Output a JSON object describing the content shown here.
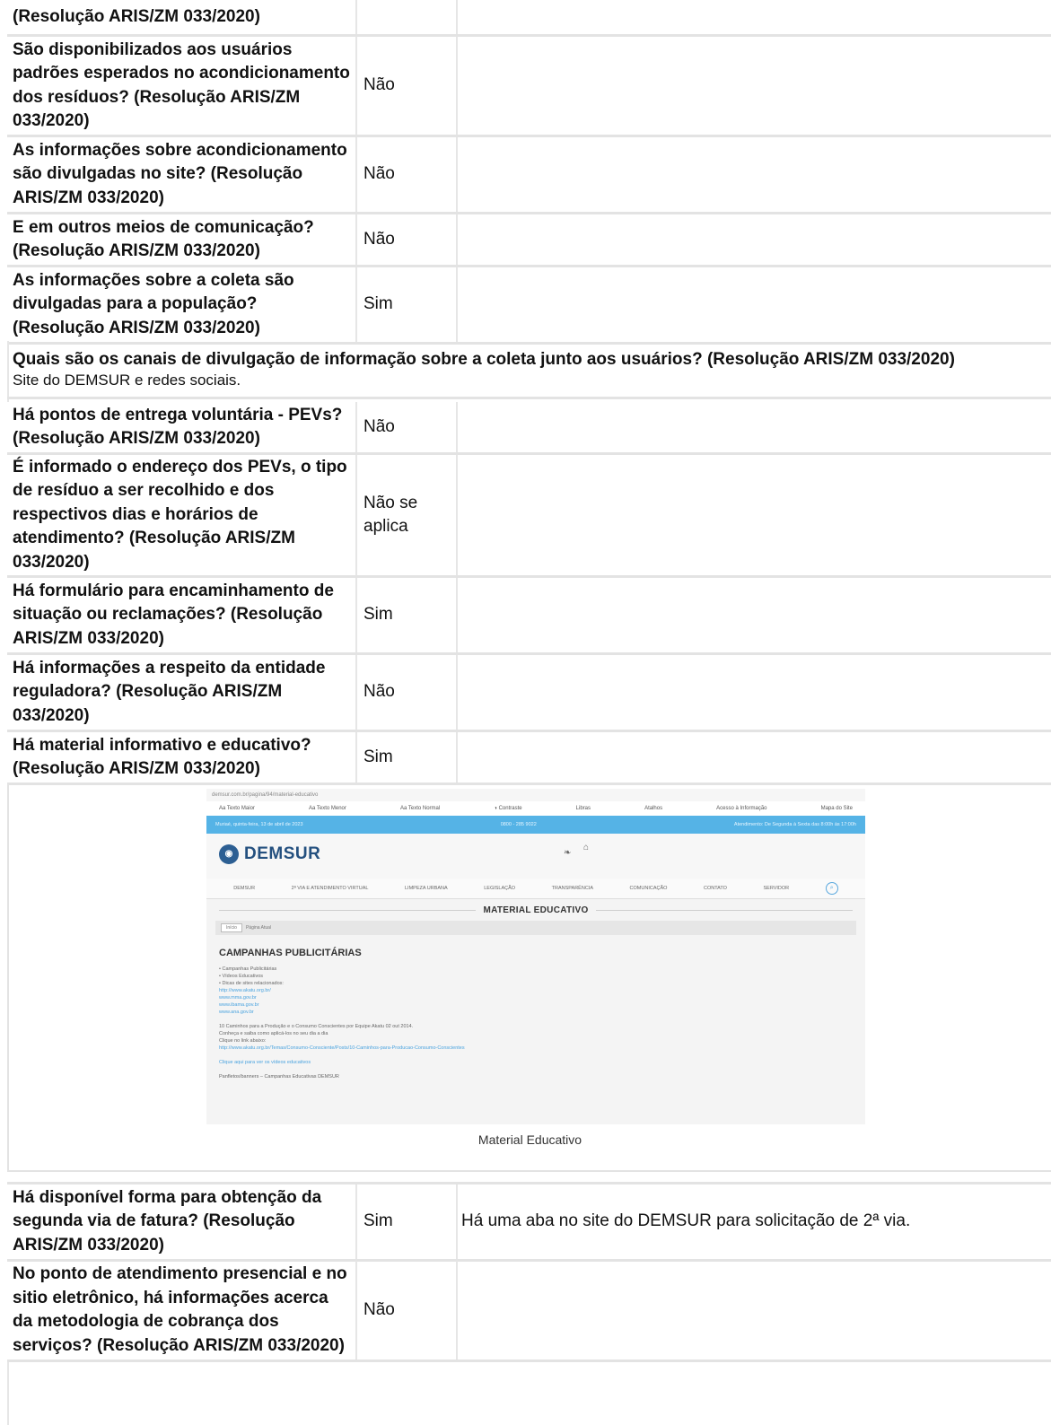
{
  "rows_top": [
    {
      "question": "(Resolução ARIS/ZM 033/2020)",
      "answer": "",
      "comment": ""
    },
    {
      "question": "São disponibilizados aos usuários padrões esperados no acondicionamento dos resíduos? (Resolução ARIS/ZM 033/2020)",
      "answer": "Não",
      "comment": ""
    },
    {
      "question": "As informações sobre acondicionamento são divulgadas no site? (Resolução ARIS/ZM 033/2020)",
      "answer": "Não",
      "comment": ""
    },
    {
      "question": "E em outros meios de comunicação? (Resolução ARIS/ZM 033/2020)",
      "answer": "Não",
      "comment": ""
    },
    {
      "question": "As informações sobre a coleta são divulgadas para a população? (Resolução ARIS/ZM 033/2020)",
      "answer": "Sim",
      "comment": ""
    }
  ],
  "full_row": {
    "question": "Quais são os canais de divulgação de informação sobre a coleta junto aos usuários? (Resolução ARIS/ZM 033/2020)",
    "answer": "Site do DEMSUR e redes sociais."
  },
  "rows_mid": [
    {
      "question": "Há pontos de entrega voluntária - PEVs? (Resolução ARIS/ZM 033/2020)",
      "answer": "Não",
      "comment": ""
    },
    {
      "question": "É informado o endereço dos PEVs, o tipo de resíduo a ser recolhido e dos respectivos dias e horários de atendimento? (Resolução ARIS/ZM 033/2020)",
      "answer": "Não se aplica",
      "comment": ""
    },
    {
      "question": "Há formulário para encaminhamento de situação ou reclamações? (Resolução ARIS/ZM 033/2020)",
      "answer": "Sim",
      "comment": ""
    },
    {
      "question": "Há informações a respeito da entidade reguladora? (Resolução ARIS/ZM 033/2020)",
      "answer": "Não",
      "comment": ""
    },
    {
      "question": "Há material informativo e educativo? (Resolução ARIS/ZM 033/2020)",
      "answer": "Sim",
      "comment": ""
    }
  ],
  "image": {
    "caption": "Material Educativo",
    "screenshot": {
      "url": "demsur.com.br/pagina/94/material-educativo",
      "tools": [
        "Aa Texto Maior",
        "Aa Texto Menor",
        "Aa Texto Normal",
        "◑ Contraste",
        "Libras",
        "Atalhos",
        "Acesso à Informação",
        "Mapa do Site"
      ],
      "date": "Muriaé, quinta-feira, 13 de abril de 2023",
      "phone": "0800 - 285 9022",
      "hours": "Atendimento: De Segunda à Sexta das 8:00h às 17:00h",
      "logo": "DEMSUR",
      "nav": [
        "DEMSUR",
        "2ª VIA E ATENDIMENTO VIRTUAL",
        "LIMPEZA URBANA",
        "LEGISLAÇÃO",
        "TRANSPARÊNCIA",
        "COMUNICAÇÃO",
        "CONTATO",
        "SERVIDOR"
      ],
      "title": "MATERIAL EDUCATIVO",
      "breadcrumb_home": "Início",
      "breadcrumb_current": "Página Atual",
      "heading": "CAMPANHAS PUBLICITÁRIAS",
      "list": [
        "Campanhas Publicitárias",
        "Vídeos Educativos",
        "Dicas de sites relacionados:"
      ],
      "links": [
        "http://www.akatu.org.br/",
        "www.mma.gov.br",
        "www.ibama.gov.br",
        "www.ana.gov.br"
      ],
      "text1": "10 Caminhos para a Produção e o Consumo Conscientes por Equipe Akatu 02 out 2014.",
      "text2": "Conheça e saiba como aplicá-los no seu dia a dia",
      "text3": "Clique no link abaixo:",
      "link_long": "http://www.akatu.org.br/Temas/Consumo-Consciente/Posts/10-Caminhos-para-Producao-Consumo-Conscientes",
      "link_videos": "Clique aqui para ver os vídeos educativos",
      "footer_text": "Panfletos/banners – Campanhas Educativas DEMSUR"
    }
  },
  "rows_bottom": [
    {
      "question": "Há disponível forma para obtenção da segunda via de fatura? (Resolução ARIS/ZM 033/2020)",
      "answer": "Sim",
      "comment": "Há uma aba no site do DEMSUR para solicitação de 2ª via."
    },
    {
      "question": "No ponto de atendimento presencial e no sitio eletrônico, há informações acerca da metodologia de cobrança dos serviços? (Resolução ARIS/ZM 033/2020)",
      "answer": "Não",
      "comment": ""
    }
  ]
}
